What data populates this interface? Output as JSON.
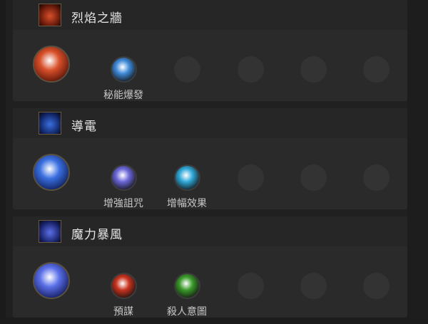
{
  "skills": [
    {
      "name": "烈焰之牆",
      "icon": "firewall-skill-icon",
      "colors": {
        "main": "#d8502a",
        "main_dark": "#5a1408"
      },
      "supports": [
        {
          "label": "秘能爆發",
          "icon": "arcane-surge-gem-icon",
          "color": "#3f8ad8"
        },
        null,
        null,
        null,
        null
      ]
    },
    {
      "name": "導電",
      "icon": "conductivity-skill-icon",
      "colors": {
        "main": "#3a6fe0",
        "main_dark": "#0e1f5a"
      },
      "supports": [
        {
          "label": "增強詛咒",
          "icon": "enhanced-curse-gem-icon",
          "color": "#6a66d8"
        },
        {
          "label": "增幅效果",
          "icon": "amplify-effect-gem-icon",
          "color": "#2fa8d8"
        },
        null,
        null,
        null
      ]
    },
    {
      "name": "魔力暴風",
      "icon": "mana-tempest-skill-icon",
      "colors": {
        "main": "#5a6fe8",
        "main_dark": "#141c5e"
      },
      "supports": [
        {
          "label": "預謀",
          "icon": "premeditation-gem-icon",
          "color": "#c8321e"
        },
        {
          "label": "殺人意圖",
          "icon": "murderous-intent-gem-icon",
          "color": "#3a9a2a"
        },
        null,
        null,
        null
      ]
    }
  ]
}
